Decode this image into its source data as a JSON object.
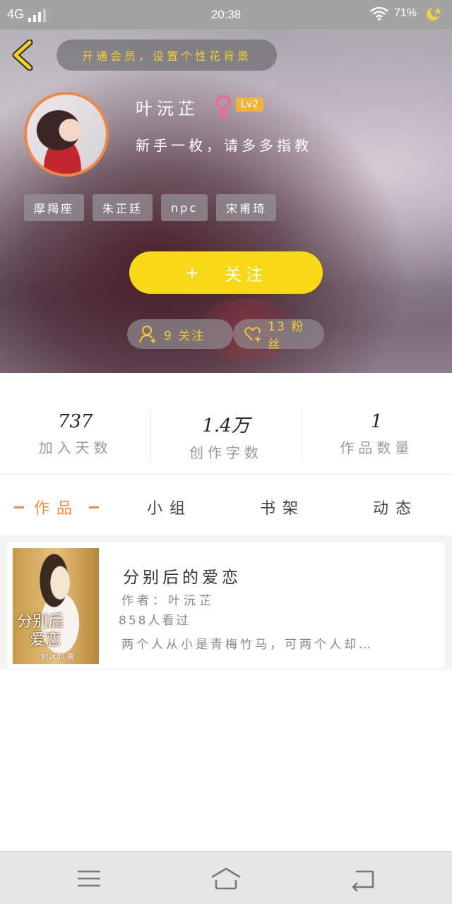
{
  "status_bar": {
    "network": "4G",
    "time": "20:38",
    "battery": "71%"
  },
  "header": {
    "notice": "开通会员，设置个性花背景",
    "username": "叶沅芷",
    "level": "Lv2",
    "bio": "新手一枚，请多多指教",
    "tags": [
      "摩羯座",
      "朱正廷",
      "npc",
      "宋甫琦"
    ],
    "follow_label": "关注",
    "follow_plus": "+",
    "following": "9 关注",
    "fans": "13 粉丝"
  },
  "stats": [
    {
      "value": "737",
      "label": "加入天数"
    },
    {
      "value": "1.4万",
      "label": "创作字数"
    },
    {
      "value": "1",
      "label": "作品数量"
    }
  ],
  "tabs": [
    "作品",
    "小组",
    "书架",
    "动态"
  ],
  "book": {
    "cover_title_line1": "分别后",
    "cover_title_line2": "爱恋",
    "cover_author": "韩沐颜 著",
    "title": "分别后的爱恋",
    "author": "作者：叶沅芷",
    "reads": "858人看过",
    "summary": "两个人从小是青梅竹马，可两个人却…"
  },
  "colors": {
    "accent_yellow": "#f7d916",
    "accent_orange": "#f28b45",
    "notice_text": "#f1cf2d"
  },
  "icons": [
    "back-chevron-icon",
    "female-icon",
    "person-add-icon",
    "heart-plus-icon",
    "menu-icon",
    "home-icon",
    "back-icon",
    "wifi-icon",
    "moon-icon"
  ]
}
